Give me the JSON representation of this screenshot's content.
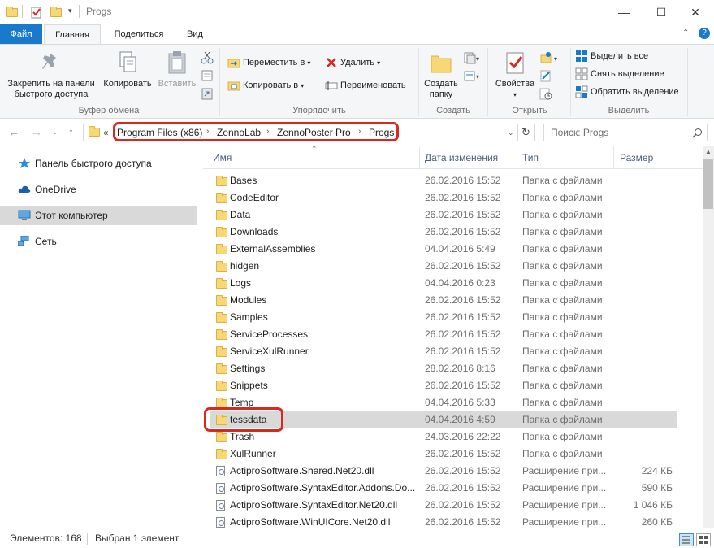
{
  "window": {
    "title": "Progs",
    "controls": {
      "minimize": "—",
      "maximize": "☐",
      "close": "✕"
    }
  },
  "ribbon_tabs": [
    "Файл",
    "Главная",
    "Поделиться",
    "Вид"
  ],
  "ribbon": {
    "clipboard": {
      "pin_line1": "Закрепить на панели",
      "pin_line2": "быстрого доступа",
      "copy": "Копировать",
      "paste": "Вставить",
      "label": "Буфер обмена"
    },
    "organize": {
      "move": "Переместить в",
      "copy_to": "Копировать в",
      "delete": "Удалить",
      "rename": "Переименовать",
      "label": "Упорядочить"
    },
    "new": {
      "folder_line1": "Создать",
      "folder_line2": "папку",
      "label": "Создать"
    },
    "open": {
      "properties": "Свойства",
      "label": "Открыть"
    },
    "select": {
      "select_all": "Выделить все",
      "select_none": "Снять выделение",
      "invert": "Обратить выделение",
      "label": "Выделить"
    }
  },
  "address": {
    "prefix": "«",
    "crumbs": [
      "Program Files (x86)",
      "ZennoLab",
      "ZennoPoster Pro",
      "Progs"
    ],
    "search_placeholder": "Поиск: Progs"
  },
  "nav": [
    {
      "label": "Панель быстрого доступа",
      "icon": "star-icon",
      "selected": false
    },
    {
      "label": "OneDrive",
      "icon": "cloud-icon",
      "selected": false
    },
    {
      "label": "Этот компьютер",
      "icon": "computer-icon",
      "selected": true
    },
    {
      "label": "Сеть",
      "icon": "network-icon",
      "selected": false
    }
  ],
  "columns": {
    "name": "Имя",
    "date": "Дата изменения",
    "type": "Тип",
    "size": "Размер"
  },
  "files": [
    {
      "name": "Bases",
      "date": "26.02.2016 15:52",
      "type": "Папка с файлами",
      "size": "",
      "kind": "folder"
    },
    {
      "name": "CodeEditor",
      "date": "26.02.2016 15:52",
      "type": "Папка с файлами",
      "size": "",
      "kind": "folder"
    },
    {
      "name": "Data",
      "date": "26.02.2016 15:52",
      "type": "Папка с файлами",
      "size": "",
      "kind": "folder"
    },
    {
      "name": "Downloads",
      "date": "26.02.2016 15:52",
      "type": "Папка с файлами",
      "size": "",
      "kind": "folder"
    },
    {
      "name": "ExternalAssemblies",
      "date": "04.04.2016 5:49",
      "type": "Папка с файлами",
      "size": "",
      "kind": "folder"
    },
    {
      "name": "hidgen",
      "date": "26.02.2016 15:52",
      "type": "Папка с файлами",
      "size": "",
      "kind": "folder"
    },
    {
      "name": "Logs",
      "date": "04.04.2016 0:23",
      "type": "Папка с файлами",
      "size": "",
      "kind": "folder"
    },
    {
      "name": "Modules",
      "date": "26.02.2016 15:52",
      "type": "Папка с файлами",
      "size": "",
      "kind": "folder"
    },
    {
      "name": "Samples",
      "date": "26.02.2016 15:52",
      "type": "Папка с файлами",
      "size": "",
      "kind": "folder"
    },
    {
      "name": "ServiceProcesses",
      "date": "26.02.2016 15:52",
      "type": "Папка с файлами",
      "size": "",
      "kind": "folder"
    },
    {
      "name": "ServiceXulRunner",
      "date": "26.02.2016 15:52",
      "type": "Папка с файлами",
      "size": "",
      "kind": "folder"
    },
    {
      "name": "Settings",
      "date": "28.02.2016 8:16",
      "type": "Папка с файлами",
      "size": "",
      "kind": "folder"
    },
    {
      "name": "Snippets",
      "date": "26.02.2016 15:52",
      "type": "Папка с файлами",
      "size": "",
      "kind": "folder"
    },
    {
      "name": "Temp",
      "date": "04.04.2016 5:33",
      "type": "Папка с файлами",
      "size": "",
      "kind": "folder"
    },
    {
      "name": "tessdata",
      "date": "04.04.2016 4:59",
      "type": "Папка с файлами",
      "size": "",
      "kind": "folder",
      "selected": true
    },
    {
      "name": "Trash",
      "date": "24.03.2016 22:22",
      "type": "Папка с файлами",
      "size": "",
      "kind": "folder"
    },
    {
      "name": "XulRunner",
      "date": "26.02.2016 15:52",
      "type": "Папка с файлами",
      "size": "",
      "kind": "folder"
    },
    {
      "name": "ActiproSoftware.Shared.Net20.dll",
      "date": "26.02.2016 15:52",
      "type": "Расширение при...",
      "size": "224 КБ",
      "kind": "dll"
    },
    {
      "name": "ActiproSoftware.SyntaxEditor.Addons.Do...",
      "date": "26.02.2016 15:52",
      "type": "Расширение при...",
      "size": "590 КБ",
      "kind": "dll"
    },
    {
      "name": "ActiproSoftware.SyntaxEditor.Net20.dll",
      "date": "26.02.2016 15:52",
      "type": "Расширение при...",
      "size": "1 046 КБ",
      "kind": "dll"
    },
    {
      "name": "ActiproSoftware.WinUICore.Net20.dll",
      "date": "26.02.2016 15:52",
      "type": "Расширение при...",
      "size": "260 КБ",
      "kind": "dll"
    }
  ],
  "status": {
    "count": "Элементов: 168",
    "selected": "Выбран 1 элемент"
  },
  "colors": {
    "accent": "#1979ca",
    "highlight": "#d9281e",
    "folder": "#f8d775",
    "selection": "#d9d9d9"
  }
}
